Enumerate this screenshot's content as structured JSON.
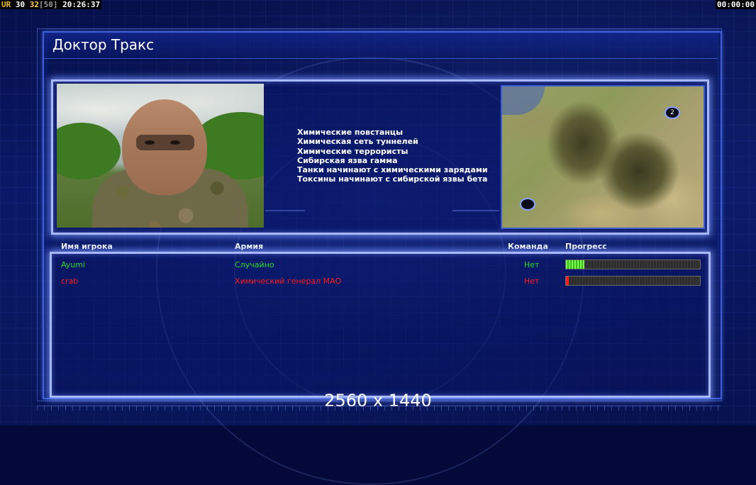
{
  "hud": {
    "ur_label": "UR",
    "value_a": "30",
    "value_b": "32",
    "value_c": "[50]",
    "clock": "20:26:37",
    "timer": "00:00:00"
  },
  "screen": {
    "title": "Доктор Тракс",
    "resolution_text": "2560 x 1440"
  },
  "general": {
    "portrait_icon": "masked-general-portrait",
    "objectives": [
      "Химические повстанцы",
      "Химическая сеть туннелей",
      "Химические террористы",
      "Сибирская язва гамма",
      "Танки начинают с химическими зарядами",
      "Токсины начинают с сибирской язвы бета"
    ]
  },
  "minimap": {
    "icon": "map-preview",
    "spawn_2_label": "2"
  },
  "players_table": {
    "headers": {
      "name": "Имя игрока",
      "army": "Армия",
      "team": "Команда",
      "progress": "Прогресс"
    },
    "rows": [
      {
        "name": "Ayumi",
        "army": "Случайно",
        "team": "Нет",
        "progress": 0.14,
        "color": "#27d82a"
      },
      {
        "name": "crab",
        "army": "Химический генерал МАО",
        "team": "Нет",
        "progress": 0.02,
        "color": "#ff1c1c"
      }
    ]
  },
  "colors": {
    "panel_border": "#a8b8ff",
    "background": "#04093a"
  }
}
